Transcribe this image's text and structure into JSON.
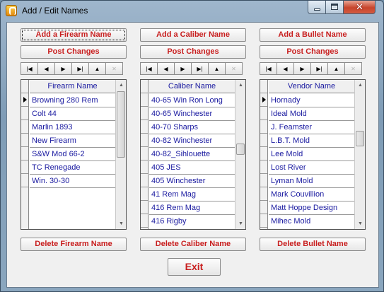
{
  "window": {
    "title": "Add / Edit Names",
    "close_glyph": "✕"
  },
  "nav_glyphs": {
    "first": "|◀",
    "prev": "◀",
    "next": "▶",
    "last": "▶|",
    "post": "▲",
    "cancel": "✕"
  },
  "firearm": {
    "add_label": "Add a Firearm Name",
    "post_label": "Post Changes",
    "delete_label": "Delete Firearm Name",
    "column_header": "Firearm Name",
    "rows": [
      "Browning 280 Rem",
      "Colt 44",
      "Marlin 1893",
      "New Firearm",
      "S&W Mod 66-2",
      "TC Renegade",
      "Win. 30-30",
      "",
      "",
      ""
    ]
  },
  "caliber": {
    "add_label": "Add a Caliber Name",
    "post_label": "Post Changes",
    "delete_label": "Delete Caliber Name",
    "column_header": "Caliber Name",
    "rows": [
      "40-65 Win Ron Long",
      "40-65 Winchester",
      "40-70 Sharps",
      "40-82 Winchester",
      "40-82_Sihlouette",
      "405 JES",
      "405 Winchester",
      "41 Rem Mag",
      "416 Rem Mag",
      "416 Rigby"
    ]
  },
  "bullet": {
    "add_label": "Add a Bullet Name",
    "post_label": "Post Changes",
    "delete_label": "Delete Bullet Name",
    "column_header": "Vendor Name",
    "rows": [
      "Hornady",
      "Ideal Mold",
      "J. Feamster",
      "L.B.T. Mold",
      "Lee Mold",
      "Lost River",
      "Lyman Mold",
      "Mark Couvillion",
      "Matt Hoppe Design",
      "Mihec Mold"
    ]
  },
  "exit_label": "Exit",
  "colors": {
    "button_text": "#c81e1e",
    "grid_text": "#1a1aa0"
  }
}
